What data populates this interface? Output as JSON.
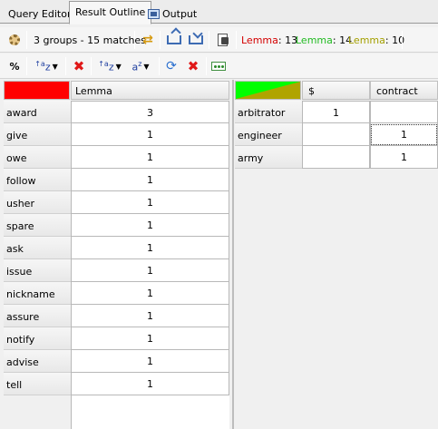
{
  "tabs": [
    {
      "label": "Query Editor"
    },
    {
      "label": "Result Outline"
    },
    {
      "label": "Output",
      "icon": "output-window-icon"
    }
  ],
  "toolbar1": {
    "summary": "3 groups - 15 matches",
    "counts": [
      {
        "name": "Lemma",
        "value": "13",
        "color": "#d40000"
      },
      {
        "name": "Lemma",
        "value": "14",
        "color": "#22bb22"
      },
      {
        "name": "Lemma",
        "value": "10",
        "color": "#a4a000"
      }
    ]
  },
  "toolbar2": {
    "percent_label": "%"
  },
  "left_table": {
    "header_color": "#ff0000",
    "column": "Lemma",
    "rows": [
      {
        "label": "award",
        "value": "3"
      },
      {
        "label": "give",
        "value": "1"
      },
      {
        "label": "owe",
        "value": "1"
      },
      {
        "label": "follow",
        "value": "1"
      },
      {
        "label": "usher",
        "value": "1"
      },
      {
        "label": "spare",
        "value": "1"
      },
      {
        "label": "ask",
        "value": "1"
      },
      {
        "label": "issue",
        "value": "1"
      },
      {
        "label": "nickname",
        "value": "1"
      },
      {
        "label": "assure",
        "value": "1"
      },
      {
        "label": "notify",
        "value": "1"
      },
      {
        "label": "advise",
        "value": "1"
      },
      {
        "label": "tell",
        "value": "1"
      }
    ]
  },
  "right_table": {
    "header_colors": [
      "#00ff00",
      "#b0a400"
    ],
    "columns": [
      "$",
      "contract"
    ],
    "rows": [
      {
        "label": "arbitrator",
        "values": [
          "1",
          ""
        ]
      },
      {
        "label": "engineer",
        "values": [
          "",
          "1"
        ]
      },
      {
        "label": "army",
        "values": [
          "",
          "1"
        ]
      }
    ]
  }
}
